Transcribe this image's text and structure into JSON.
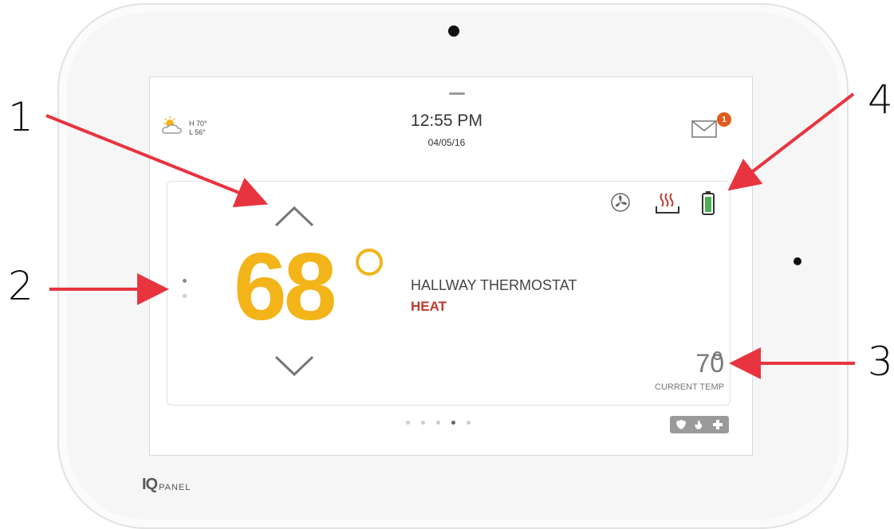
{
  "weather": {
    "high": "H 70°",
    "low": "L 56°",
    "icon": "partly-sunny-icon"
  },
  "clock": {
    "time": "12:55 PM",
    "date": "04/05/16"
  },
  "messages": {
    "unread_count": "1",
    "icon": "mail-icon"
  },
  "thermostat": {
    "setpoint": "68",
    "name": "HALLWAY THERMOSTAT",
    "mode": "HEAT",
    "current_temp": "70",
    "current_temp_label": "CURRENT TEMP",
    "status_icons": [
      "fan-icon",
      "heat-icon",
      "battery-icon"
    ]
  },
  "pager": {
    "total": 5,
    "active_index": 3
  },
  "emergency_icons": [
    "shield-icon",
    "fire-icon",
    "plus-icon"
  ],
  "brand": {
    "iq": "IQ",
    "panel": "PANEL"
  },
  "callouts": [
    "1",
    "2",
    "3",
    "4"
  ],
  "colors": {
    "setpoint": "#f3b419",
    "mode": "#c0392b",
    "arrow": "#e8343f",
    "badge": "#e25b1c",
    "battery": "#4caf50"
  }
}
